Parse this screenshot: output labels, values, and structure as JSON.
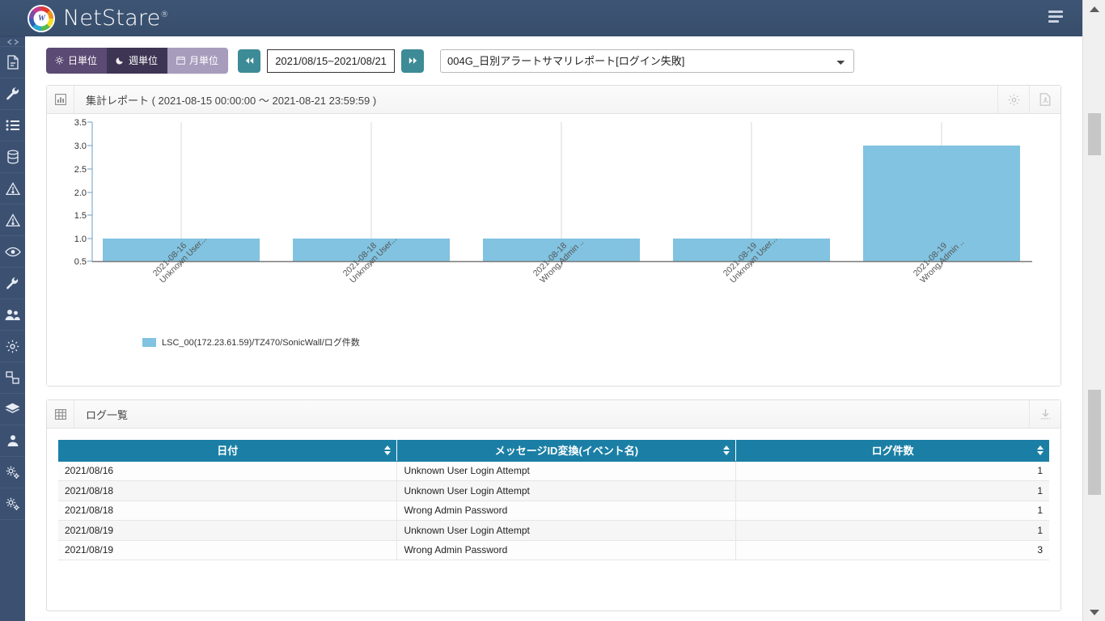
{
  "header": {
    "brand": "NetStare",
    "brand_sup": "®",
    "logo_glyph": "W",
    "menu_icon": "hamburger-menu-icon"
  },
  "sidebar": {
    "items": [
      {
        "icon": "collapse-chevrons-icon",
        "label": ""
      },
      {
        "icon": "document-report-icon",
        "label": ""
      },
      {
        "icon": "tools-wrench-icon",
        "label": ""
      },
      {
        "icon": "list-icon",
        "label": ""
      },
      {
        "icon": "database-icon",
        "label": ""
      },
      {
        "icon": "alert-triangle-icon",
        "label": ""
      },
      {
        "icon": "alert-triangle-icon",
        "label": ""
      },
      {
        "icon": "eye-monitor-icon",
        "label": ""
      },
      {
        "icon": "wrench-icon",
        "label": ""
      },
      {
        "icon": "users-group-icon",
        "label": ""
      },
      {
        "icon": "gear-icon",
        "label": ""
      },
      {
        "icon": "network-nodes-icon",
        "label": ""
      },
      {
        "icon": "layers-icon",
        "label": ""
      },
      {
        "icon": "user-admin-icon",
        "label": ""
      },
      {
        "icon": "gears-settings-icon",
        "label": ""
      },
      {
        "icon": "gears-settings-icon",
        "label": ""
      }
    ]
  },
  "toolbar": {
    "unit_buttons": [
      {
        "label": "日単位",
        "icon": "sun-icon",
        "state": "normal"
      },
      {
        "label": "週単位",
        "icon": "moon-icon",
        "state": "normal"
      },
      {
        "label": "月単位",
        "icon": "calendar-icon",
        "state": "active"
      }
    ],
    "prev_label": "◀◀",
    "next_label": "▶▶",
    "date_range": "2021/08/15~2021/08/21",
    "report_selected": "004G_日別アラートサマリレポート[ログイン失敗]",
    "report_options": [
      "004G_日別アラートサマリレポート[ログイン失敗]"
    ]
  },
  "chart_panel": {
    "title": "集計レポート ( 2021-08-15 00:00:00 ～ 2021-08-21 23:59:59 )",
    "head_icon": "bar-chart-icon",
    "settings_icon": "gear-icon",
    "pdf_icon": "pdf-export-icon"
  },
  "table_panel": {
    "title": "ログ一覧",
    "head_icon": "table-grid-icon",
    "download_icon": "download-icon"
  },
  "chart_data": {
    "type": "bar",
    "title": "集計レポート ( 2021-08-15 00:00:00 ～ 2021-08-21 23:59:59 )",
    "xlabel": "",
    "ylabel": "",
    "ylim": [
      0.5,
      3.5
    ],
    "yticks": [
      "0.5",
      "1.0",
      "1.5",
      "2.0",
      "2.5",
      "3.0",
      "3.5"
    ],
    "grid": true,
    "legend_position": "bottom-left",
    "categories": [
      "2021-08-16\nUnknown User...",
      "2021-08-18\nUnknown User...",
      "2021-08-18\nWrong Admin ...",
      "2021-08-19\nUnknown User...",
      "2021-08-19\nWrong Admin ..."
    ],
    "series": [
      {
        "name": "LSC_00(172.23.61.59)/TZ470/SonicWall/ログ件数",
        "color": "#81c3e0",
        "values": [
          1,
          1,
          1,
          1,
          3
        ]
      }
    ]
  },
  "log_table": {
    "columns": [
      "日付",
      "メッセージID変換(イベント名)",
      "ログ件数"
    ],
    "rows": [
      [
        "2021/08/16",
        "Unknown User Login Attempt",
        "1"
      ],
      [
        "2021/08/18",
        "Unknown User Login Attempt",
        "1"
      ],
      [
        "2021/08/18",
        "Wrong Admin Password",
        "1"
      ],
      [
        "2021/08/19",
        "Unknown User Login Attempt",
        "1"
      ],
      [
        "2021/08/19",
        "Wrong Admin Password",
        "3"
      ]
    ]
  },
  "colors": {
    "header_bg": "#3e5575",
    "rail_bg": "#3c5172",
    "bar": "#81c3e0",
    "table_header": "#1b7fa5",
    "teal_button": "#3d8b96"
  }
}
